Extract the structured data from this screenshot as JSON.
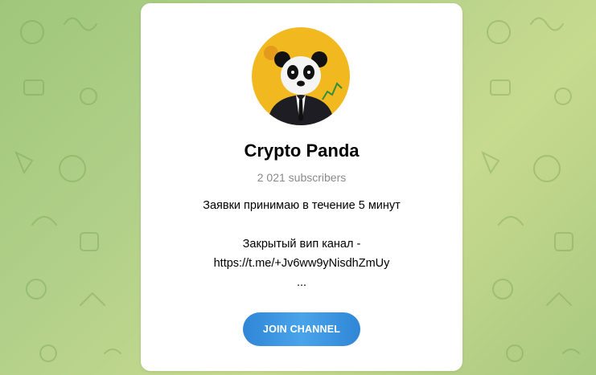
{
  "channel": {
    "title": "Crypto Panda",
    "subscribers": "2 021 subscribers",
    "avatar_icon": "panda-in-suit-avatar",
    "description_lines": [
      "Заявки принимаю в течение 5 минут",
      "",
      "Закрытый вип канал -",
      "https://t.me/+Jv6ww9yNisdhZmUy",
      "..."
    ]
  },
  "actions": {
    "join_label": "JOIN CHANNEL"
  },
  "colors": {
    "background_start": "#9fc77a",
    "background_end": "#c7da8e",
    "card": "#ffffff",
    "button": "#2f86d6",
    "subtitle": "#8a8a8a",
    "avatar_background": "#f2b820"
  }
}
